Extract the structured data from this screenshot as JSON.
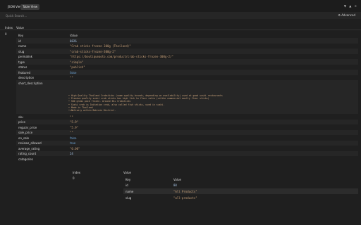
{
  "toolbar": {
    "json_tab": "JSON View",
    "table_tab": "Table View",
    "icons": [
      "arrow-down-icon",
      "arrow-up-icon",
      "close-icon"
    ]
  },
  "search": {
    "placeholder": "Quick Search...",
    "advanced_label": "⚙ Advanced"
  },
  "outer": {
    "index_header": "Index",
    "value_header": "Value",
    "index_value": "0"
  },
  "table": {
    "key_header": "Key",
    "value_header": "Value",
    "rows": [
      {
        "key": "id",
        "value": "6826"
      },
      {
        "key": "name",
        "value": "\"Crab sticks frozen 300g (Thailand)\""
      },
      {
        "key": "slug",
        "value": "\"crab-sticks-frozen-300g-2\""
      },
      {
        "key": "permalink",
        "value": "\"https://boutiqueaoto.com/product/crab-sticks-frozen-300g-2/\""
      },
      {
        "key": "type",
        "value": "\"simple\""
      },
      {
        "key": "status",
        "value": "\"publish\""
      },
      {
        "key": "featured",
        "value": "false"
      },
      {
        "key": "description",
        "value": "\"\""
      },
      {
        "key": "short_description",
        "value": "\"\""
      },
      {
        "key": "sku",
        "value": "\"\""
      },
      {
        "key": "price",
        "value": "\"5.9\""
      },
      {
        "key": "regular_price",
        "value": "\"5.9\""
      },
      {
        "key": "sale_price",
        "value": "\"\""
      },
      {
        "key": "on_sale",
        "value": "false"
      },
      {
        "key": "reviews_allowed",
        "value": "true"
      },
      {
        "key": "average_rating",
        "value": "\"0.00\""
      },
      {
        "key": "rating_count",
        "value": "24"
      },
      {
        "key": "categories",
        "value": ""
      }
    ],
    "short_description_lines": [
      "• High Quality Thailand Crabsticks (some quality brands, depending on availability) used at good sushi restaurants",
      "• Premium quality sushi crab sticks has high fish to flour ratio (unlike commercial mostly flour sticks)",
      "• 500 grams pack frozen. Around 30+ Crabsticks",
      "• Sushi crab is Imitation crab, also called fish sticks, used in sushi.",
      "• Made in Thailand",
      "• Delivery within Bahrain District."
    ]
  },
  "categories": {
    "index_header": "Index",
    "value_header": "Value",
    "index_value": "0",
    "key_header": "Key",
    "value_subheader": "Value",
    "rows": [
      {
        "key": "id",
        "value": "88"
      },
      {
        "key": "name",
        "value": "\"All Products\""
      },
      {
        "key": "slug",
        "value": "\"all-products\""
      }
    ]
  }
}
